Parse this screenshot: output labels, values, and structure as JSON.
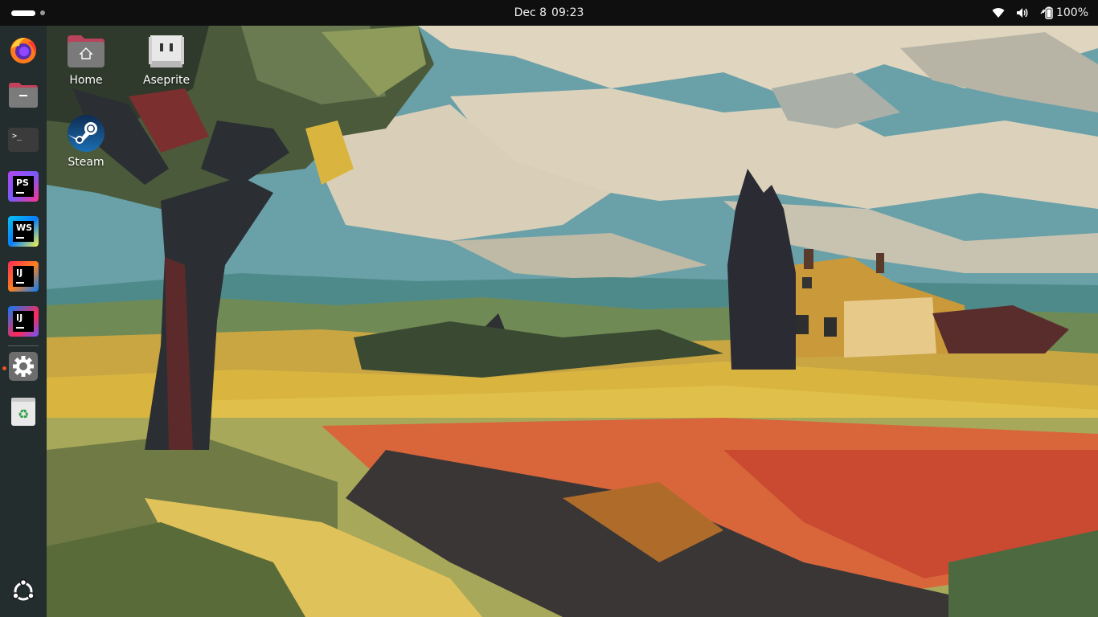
{
  "topbar": {
    "date": "Dec 8",
    "time": "09:23",
    "battery": "100%",
    "icons": [
      "wifi-icon",
      "volume-icon",
      "battery-icon"
    ]
  },
  "dock": {
    "items": [
      {
        "name": "firefox",
        "icon": "firefox-icon"
      },
      {
        "name": "files",
        "icon": "folder-icon"
      },
      {
        "name": "terminal",
        "icon": "terminal-icon",
        "glyph": ">_"
      },
      {
        "name": "phpstorm",
        "icon": "phpstorm-icon",
        "glyph": "PS"
      },
      {
        "name": "webstorm",
        "icon": "webstorm-icon",
        "glyph": "WS"
      },
      {
        "name": "intellij-idea",
        "icon": "intellij-icon",
        "glyph": "IJ"
      },
      {
        "name": "intellij-idea-ce",
        "icon": "intellij-ce-icon",
        "glyph": "IJ"
      },
      {
        "name": "settings",
        "icon": "gear-icon"
      },
      {
        "name": "trash",
        "icon": "trash-icon",
        "glyph": "♻"
      }
    ],
    "show_apps_icon": "ubuntu-apps-icon"
  },
  "desktop": {
    "icons": [
      {
        "label": "Home",
        "icon": "home-folder-icon"
      },
      {
        "label": "Aseprite",
        "icon": "aseprite-icon"
      },
      {
        "label": "Steam",
        "icon": "steam-icon"
      }
    ]
  },
  "colors": {
    "accent": "#e95420",
    "topbar": "#0f0f0f",
    "dock": "#141414"
  }
}
